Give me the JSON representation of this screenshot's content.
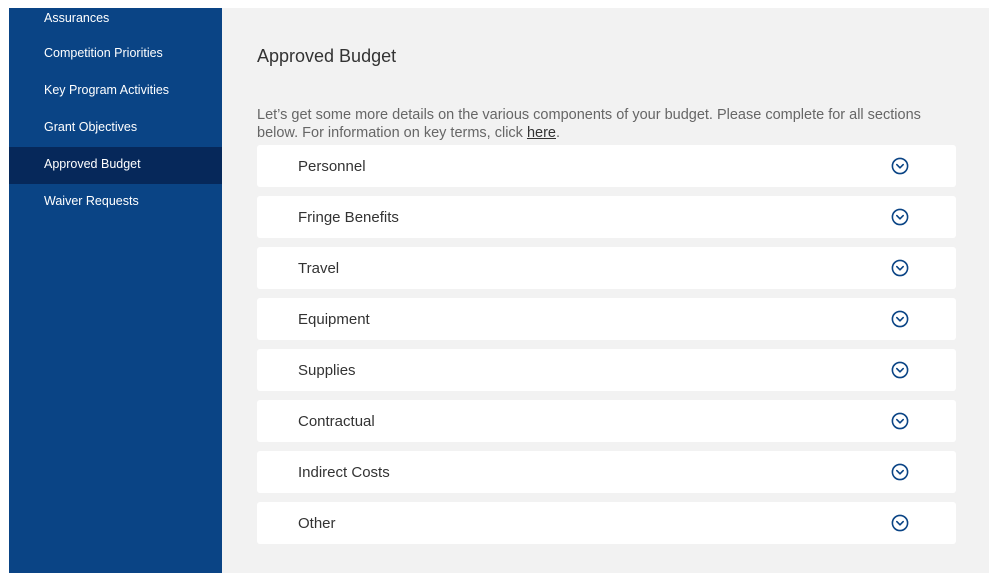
{
  "sidebar": {
    "items": [
      {
        "label": "Assurances",
        "active": false
      },
      {
        "label": "Competition Priorities",
        "active": false
      },
      {
        "label": "Key Program Activities",
        "active": false
      },
      {
        "label": "Grant Objectives",
        "active": false
      },
      {
        "label": "Approved Budget",
        "active": true
      },
      {
        "label": "Waiver Requests",
        "active": false
      }
    ]
  },
  "main": {
    "title": "Approved Budget",
    "intro_text": "Let’s get some more details on the various components of your budget. Please complete for all sections below. For information on key terms, click ",
    "intro_link": "here",
    "intro_end": ".",
    "sections": [
      {
        "label": "Personnel",
        "icon": "chevron-down-circle-icon"
      },
      {
        "label": "Fringe Benefits",
        "icon": "chevron-down-circle-icon"
      },
      {
        "label": "Travel",
        "icon": "chevron-down-circle-icon"
      },
      {
        "label": "Equipment",
        "icon": "chevron-down-circle-icon"
      },
      {
        "label": "Supplies",
        "icon": "chevron-down-circle-icon"
      },
      {
        "label": "Contractual",
        "icon": "chevron-down-circle-icon"
      },
      {
        "label": "Indirect Costs",
        "icon": "chevron-down-circle-icon"
      },
      {
        "label": "Other",
        "icon": "chevron-down-circle-icon"
      }
    ]
  },
  "colors": {
    "sidebar_bg": "#0a4485",
    "sidebar_active_bg": "#06285a",
    "main_bg": "#f2f2f2",
    "chevron": "#0a4485"
  }
}
